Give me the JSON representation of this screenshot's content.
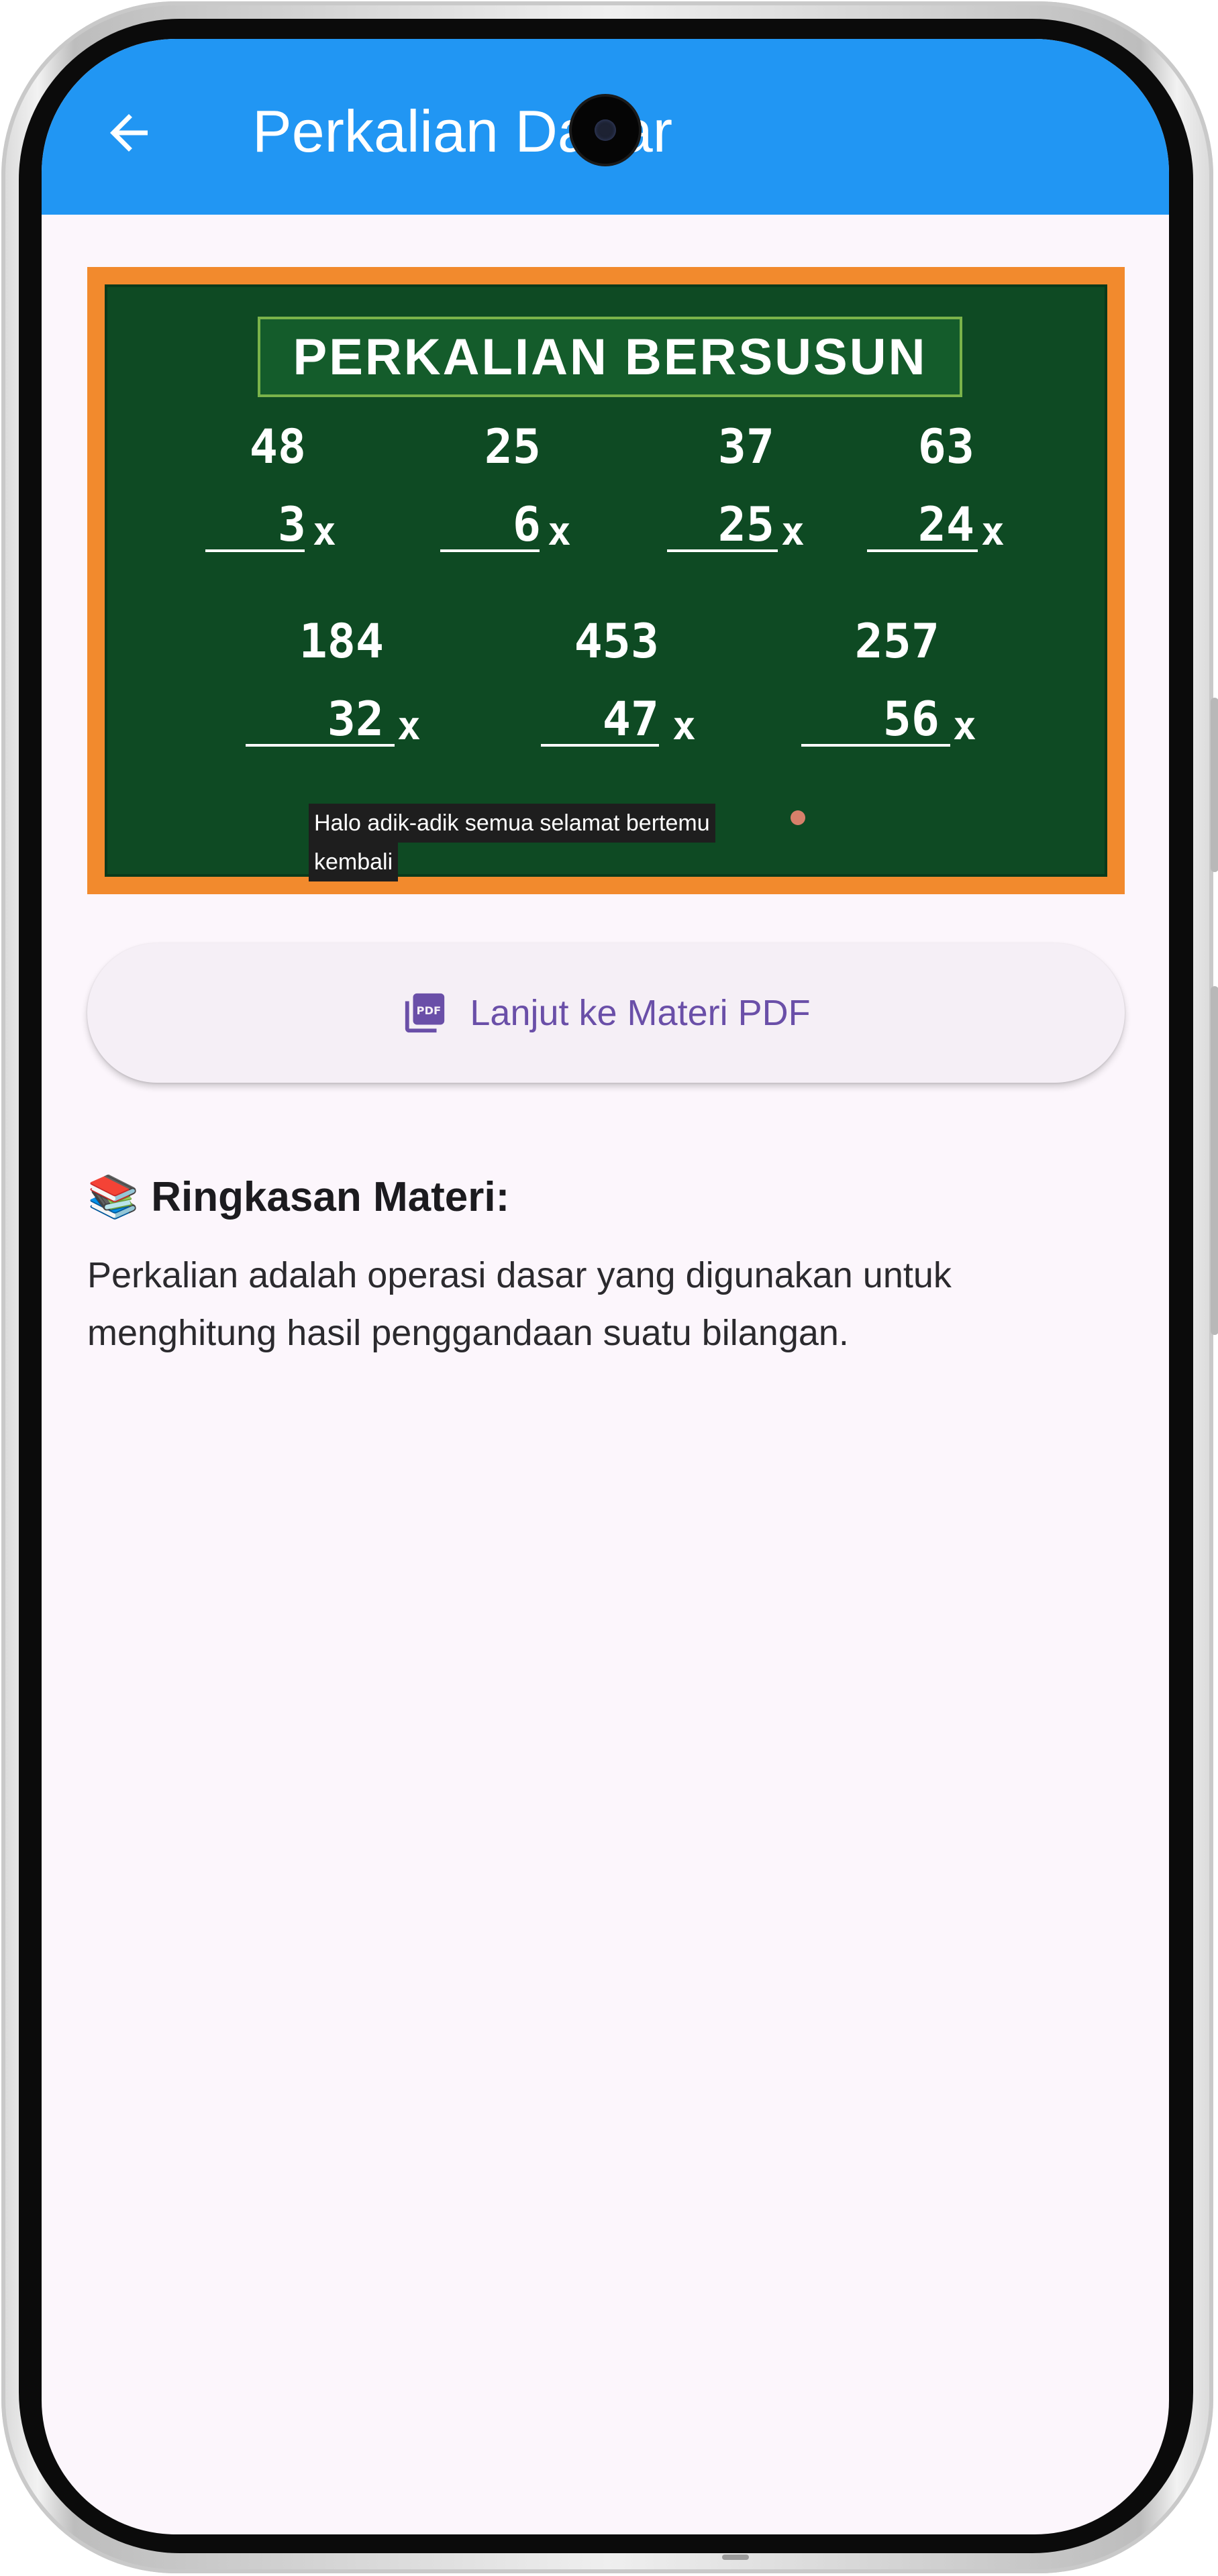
{
  "appbar": {
    "title": "Perkalian Dasar",
    "color": "#2196f3"
  },
  "icons": {
    "back": "arrow-left-icon",
    "pdf": "pdf-icon",
    "books": "books-icon"
  },
  "video": {
    "board_title": "PERKALIAN BERSUSUN",
    "problems": [
      {
        "top": "48",
        "bottom": "3",
        "op": "x"
      },
      {
        "top": "25",
        "bottom": "6",
        "op": "x"
      },
      {
        "top": "37",
        "bottom": "25",
        "op": "x"
      },
      {
        "top": "63",
        "bottom": "24",
        "op": "x"
      },
      {
        "top": "184",
        "bottom": "32",
        "op": "x"
      },
      {
        "top": "453",
        "bottom": "47",
        "op": "x"
      },
      {
        "top": "257",
        "bottom": "56",
        "op": "x"
      }
    ],
    "caption_line1": "Halo adik-adik semua selamat bertemu",
    "caption_line2": "kembali"
  },
  "pdf_button": {
    "label": "Lanjut ke Materi PDF"
  },
  "summary": {
    "emoji": "📚",
    "title": "Ringkasan Materi:",
    "body": "Perkalian adalah operasi dasar yang digunakan untuk menghitung hasil penggandaan suatu bilangan."
  }
}
